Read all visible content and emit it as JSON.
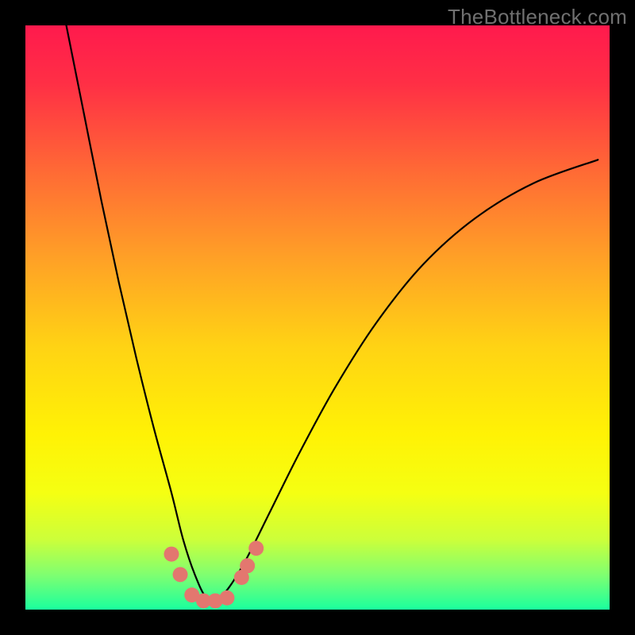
{
  "watermark": "TheBottleneck.com",
  "colors": {
    "frame": "#000000",
    "gradient_stops": [
      {
        "offset": 0.0,
        "color": "#ff1a4d"
      },
      {
        "offset": 0.1,
        "color": "#ff2f45"
      },
      {
        "offset": 0.25,
        "color": "#ff6a35"
      },
      {
        "offset": 0.4,
        "color": "#ffa126"
      },
      {
        "offset": 0.55,
        "color": "#ffd314"
      },
      {
        "offset": 0.7,
        "color": "#fff205"
      },
      {
        "offset": 0.8,
        "color": "#f5ff12"
      },
      {
        "offset": 0.88,
        "color": "#ccff3a"
      },
      {
        "offset": 0.94,
        "color": "#80ff70"
      },
      {
        "offset": 1.0,
        "color": "#1aff9e"
      }
    ],
    "curve": "#000000",
    "marker_fill": "#e3776f",
    "marker_stroke": "#e3776f"
  },
  "chart_data": {
    "type": "line",
    "title": "",
    "xlabel": "",
    "ylabel": "",
    "x_range": [
      0,
      100
    ],
    "y_range": [
      0,
      100
    ],
    "note": "V-shaped bottleneck curve; minimum near x≈31; values read from plot area where y=0 is bottom and y=100 is top.",
    "series": [
      {
        "name": "bottleneck-curve",
        "x": [
          7,
          10,
          13,
          16,
          19,
          22,
          25,
          27,
          29,
          31,
          33,
          35,
          38,
          42,
          47,
          53,
          60,
          68,
          77,
          87,
          98
        ],
        "y": [
          100,
          85,
          70,
          56,
          43,
          31,
          20,
          12,
          6,
          2,
          2,
          4,
          9,
          17,
          27,
          38,
          49,
          59,
          67,
          73,
          77
        ]
      }
    ],
    "markers": {
      "name": "highlighted-points",
      "points": [
        {
          "x": 25.0,
          "y": 9.5
        },
        {
          "x": 26.5,
          "y": 6.0
        },
        {
          "x": 28.5,
          "y": 2.5
        },
        {
          "x": 30.5,
          "y": 1.5
        },
        {
          "x": 32.5,
          "y": 1.5
        },
        {
          "x": 34.5,
          "y": 2.0
        },
        {
          "x": 37.0,
          "y": 5.5
        },
        {
          "x": 38.0,
          "y": 7.5
        },
        {
          "x": 39.5,
          "y": 10.5
        }
      ]
    }
  }
}
